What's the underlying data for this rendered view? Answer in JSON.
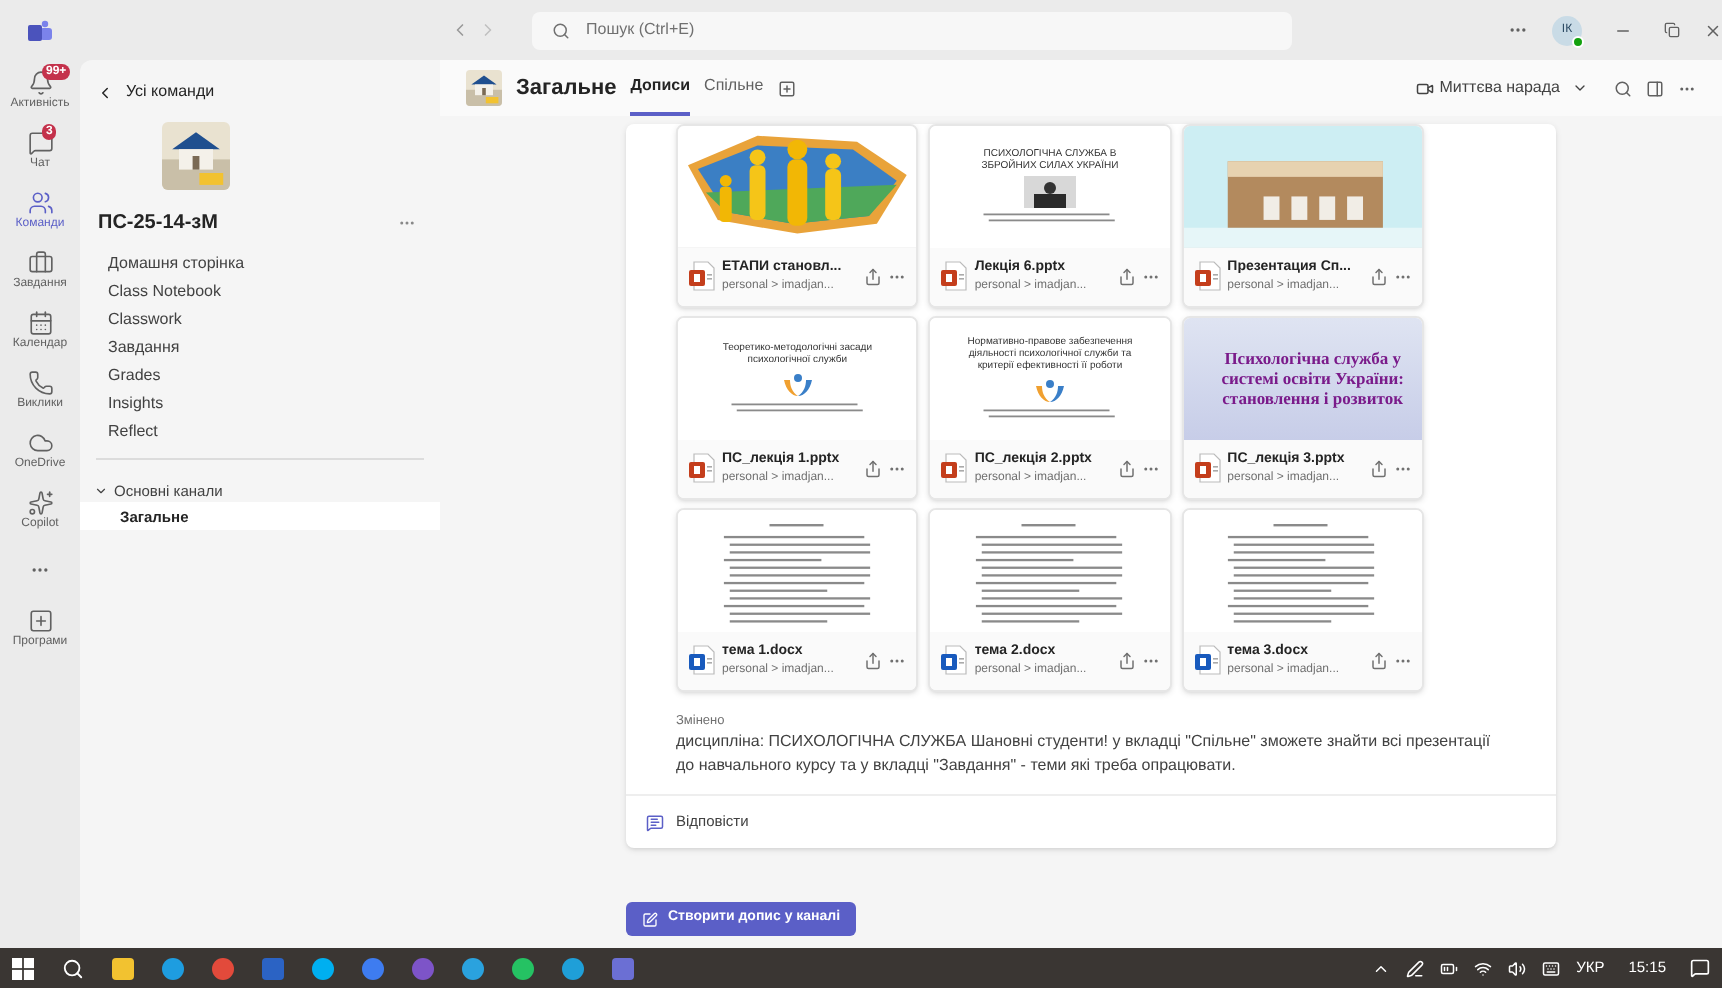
{
  "titlebar": {
    "search_placeholder": "Пошук (Ctrl+E)",
    "avatar": "ІК"
  },
  "rail": [
    {
      "label": "Активність",
      "badge": "99+",
      "selected": false
    },
    {
      "label": "Чат",
      "badge": "3",
      "selected": false
    },
    {
      "label": "Команди",
      "selected": true
    },
    {
      "label": "Завдання",
      "selected": false
    },
    {
      "label": "Календар",
      "selected": false
    },
    {
      "label": "Виклики",
      "selected": false
    },
    {
      "label": "OneDrive",
      "selected": false
    },
    {
      "label": "Copilot",
      "selected": false
    },
    {
      "label": "Програми",
      "selected": false
    }
  ],
  "sidebar": {
    "back": "Усі команди",
    "team_name": "ПС-25-14-зМ",
    "items": [
      "Домашня сторінка",
      "Class Notebook",
      "Classwork",
      "Завдання",
      "Grades",
      "Insights",
      "Reflect"
    ],
    "section": "Основні канали",
    "section_expanded": true,
    "channels": [
      {
        "label": "Загальне",
        "selected": true
      }
    ]
  },
  "header": {
    "title": "Загальне",
    "tabs": [
      {
        "label": "Дописи",
        "selected": true
      },
      {
        "label": "Спільне",
        "selected": false
      }
    ],
    "meet": "Миттєва нарада"
  },
  "post": {
    "files": [
      {
        "name": "ЕТАПИ становл...",
        "path": "personal > imadjan...",
        "kind": "presentation"
      },
      {
        "name": "Лекція 6.pptx",
        "path": "personal > imadjan...",
        "kind": "presentation",
        "preview": {
          "kind": "slide",
          "title": "ПСИХОЛОГІЧНА СЛУЖБА В ЗБРОЙНИХ СИЛАХ УКРАЇНИ"
        }
      },
      {
        "name": "Презентация Сп...",
        "path": "personal > imadjan...",
        "kind": "presentation"
      },
      {
        "name": "ПС_лекція 1.pptx",
        "path": "personal > imadjan...",
        "kind": "presentation",
        "preview": {
          "kind": "slide",
          "title": "Теоретико-методологічні засади психологічної служби"
        }
      },
      {
        "name": "ПС_лекція 2.pptx",
        "path": "personal > imadjan...",
        "kind": "presentation",
        "preview": {
          "kind": "slide",
          "title": "Нормативно-правове забезпечення діяльності психологічної служби та критерії ефективності її роботи"
        }
      },
      {
        "name": "ПС_лекція 3.pptx",
        "path": "personal > imadjan...",
        "kind": "presentation",
        "preview": {
          "kind": "title_slide",
          "title": "Психологічна служба у системі освіти України: становлення і розвиток"
        }
      },
      {
        "name": "тема 1.docx",
        "path": "personal > imadjan...",
        "kind": "document",
        "preview": {
          "kind": "doc"
        }
      },
      {
        "name": "тема 2.docx",
        "path": "personal > imadjan...",
        "kind": "document",
        "preview": {
          "kind": "doc"
        }
      },
      {
        "name": "тема 3.docx",
        "path": "personal > imadjan...",
        "kind": "document",
        "preview": {
          "kind": "doc"
        }
      }
    ],
    "edited": "Змінено",
    "message": "дисципліна: ПСИХОЛОГІЧНА СЛУЖБА Шановні студенти! у вкладці \"Спільне\" зможете знайти всі презентації до навчального курсу та у вкладці \"Завдання\" - теми які треба опрацювати.",
    "reply": "Відповісти"
  },
  "compose_button": "Створити допис у каналі",
  "taskbar": {
    "language": "УКР",
    "time": "15:15"
  }
}
